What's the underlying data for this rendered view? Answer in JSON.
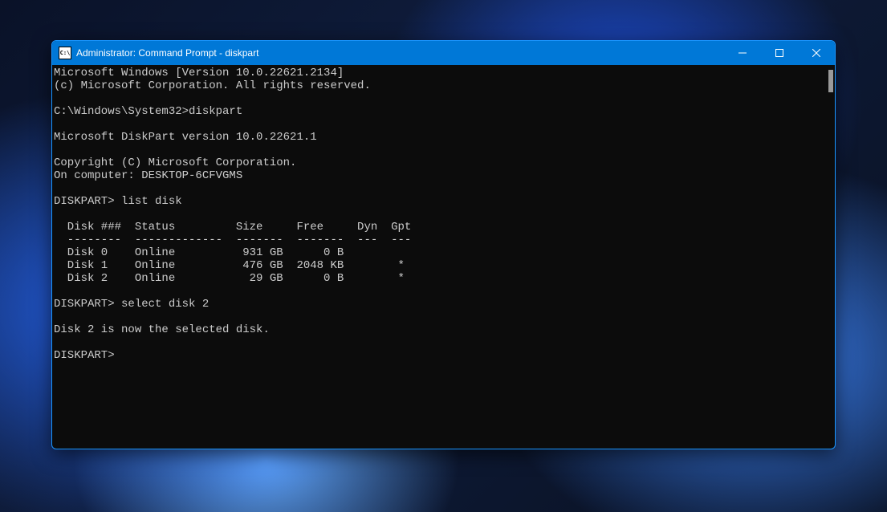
{
  "window": {
    "title": "Administrator: Command Prompt - diskpart",
    "icon_text": "C:\\"
  },
  "terminal": {
    "lines": [
      "Microsoft Windows [Version 10.0.22621.2134]",
      "(c) Microsoft Corporation. All rights reserved.",
      "",
      "C:\\Windows\\System32>diskpart",
      "",
      "Microsoft DiskPart version 10.0.22621.1",
      "",
      "Copyright (C) Microsoft Corporation.",
      "On computer: DESKTOP-6CFVGMS",
      "",
      "DISKPART> list disk",
      "",
      "  Disk ###  Status         Size     Free     Dyn  Gpt",
      "  --------  -------------  -------  -------  ---  ---",
      "  Disk 0    Online          931 GB      0 B",
      "  Disk 1    Online          476 GB  2048 KB        *",
      "  Disk 2    Online           29 GB      0 B        *",
      "",
      "DISKPART> select disk 2",
      "",
      "Disk 2 is now the selected disk.",
      "",
      "DISKPART>"
    ]
  },
  "disks": [
    {
      "num": 0,
      "status": "Online",
      "size": "931 GB",
      "free": "0 B",
      "dyn": "",
      "gpt": ""
    },
    {
      "num": 1,
      "status": "Online",
      "size": "476 GB",
      "free": "2048 KB",
      "dyn": "",
      "gpt": "*"
    },
    {
      "num": 2,
      "status": "Online",
      "size": "29 GB",
      "free": "0 B",
      "dyn": "",
      "gpt": "*"
    }
  ],
  "commands": {
    "prompt1": "C:\\Windows\\System32>",
    "cmd1": "diskpart",
    "diskpart_prompt": "DISKPART>",
    "cmd2": "list disk",
    "cmd3": "select disk 2",
    "response_select": "Disk 2 is now the selected disk."
  }
}
